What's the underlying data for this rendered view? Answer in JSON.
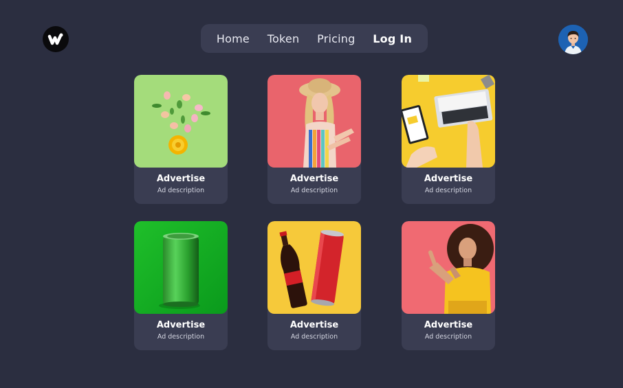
{
  "nav": {
    "items": [
      {
        "label": "Home"
      },
      {
        "label": "Token"
      },
      {
        "label": "Pricing"
      },
      {
        "label": "Log In"
      }
    ]
  },
  "cards": [
    {
      "title": "Advertise",
      "description": "Ad description",
      "image": "flowers-on-green"
    },
    {
      "title": "Advertise",
      "description": "Ad description",
      "image": "woman-pointing-on-red"
    },
    {
      "title": "Advertise",
      "description": "Ad description",
      "image": "laptop-on-yellow"
    },
    {
      "title": "Advertise",
      "description": "Ad description",
      "image": "green-can-on-green"
    },
    {
      "title": "Advertise",
      "description": "Ad description",
      "image": "cola-on-yellow"
    },
    {
      "title": "Advertise",
      "description": "Ad description",
      "image": "woman-pointing-up-on-red"
    }
  ],
  "colors": {
    "background": "#2b2e40",
    "panel": "#3a3d52"
  }
}
